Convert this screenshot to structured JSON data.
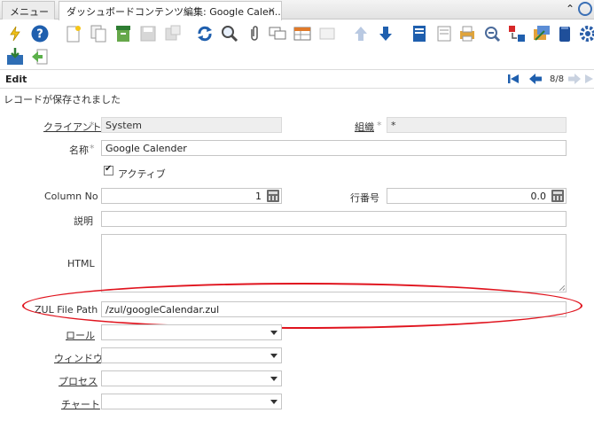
{
  "tabs": [
    {
      "label": "メニュー"
    },
    {
      "label": "ダッシュボードコンテンツ編集: Google Calen..."
    }
  ],
  "tab_close": "×",
  "tab_scroll": "⌃",
  "toolbar": {
    "buttons": [
      {
        "name": "ignore-icon"
      },
      {
        "name": "help-icon"
      },
      {
        "name": "new-record-icon"
      },
      {
        "name": "copy-record-icon"
      },
      {
        "name": "delete-icon"
      },
      {
        "name": "save-icon"
      },
      {
        "name": "save-create-icon"
      },
      {
        "name": "refresh-icon"
      },
      {
        "name": "find-icon"
      },
      {
        "name": "attachment-icon"
      },
      {
        "name": "chat-icon"
      },
      {
        "name": "grid-toggle-icon"
      },
      {
        "name": "history-icon"
      },
      {
        "name": "parent-record-icon"
      },
      {
        "name": "detail-record-icon"
      },
      {
        "name": "report-icon"
      },
      {
        "name": "archive-icon"
      },
      {
        "name": "print-icon"
      },
      {
        "name": "zoom-across-icon"
      },
      {
        "name": "request-icon"
      },
      {
        "name": "product-info-icon"
      },
      {
        "name": "export-icon"
      },
      {
        "name": "settings-icon"
      },
      {
        "name": "import-icon"
      },
      {
        "name": "back-icon"
      }
    ]
  },
  "editbar": {
    "title": "Edit",
    "record_counter": "8/8"
  },
  "status_message": "レコードが保存されました",
  "form": {
    "client": {
      "label": "クライアント",
      "value": "System"
    },
    "org": {
      "label": "組織",
      "value": "*"
    },
    "name": {
      "label": "名称",
      "value": "Google Calender"
    },
    "active": {
      "label": "アクティブ",
      "checked": true
    },
    "column_no": {
      "label": "Column No",
      "value": "1"
    },
    "line_no": {
      "label": "行番号",
      "value": "0.0"
    },
    "description": {
      "label": "説明",
      "value": ""
    },
    "html": {
      "label": "HTML",
      "value": ""
    },
    "zul_path": {
      "label": "ZUL File Path",
      "value": "/zul/googleCalendar.zul"
    },
    "role": {
      "label": "ロール",
      "value": ""
    },
    "window": {
      "label": "ウィンドウ",
      "value": ""
    },
    "process": {
      "label": "プロセス",
      "value": ""
    },
    "chart": {
      "label": "チャート",
      "value": ""
    }
  },
  "colors": {
    "accent": "#1f5fae",
    "highlight_oval": "#e0141e",
    "mandatory_label": "#333333"
  }
}
